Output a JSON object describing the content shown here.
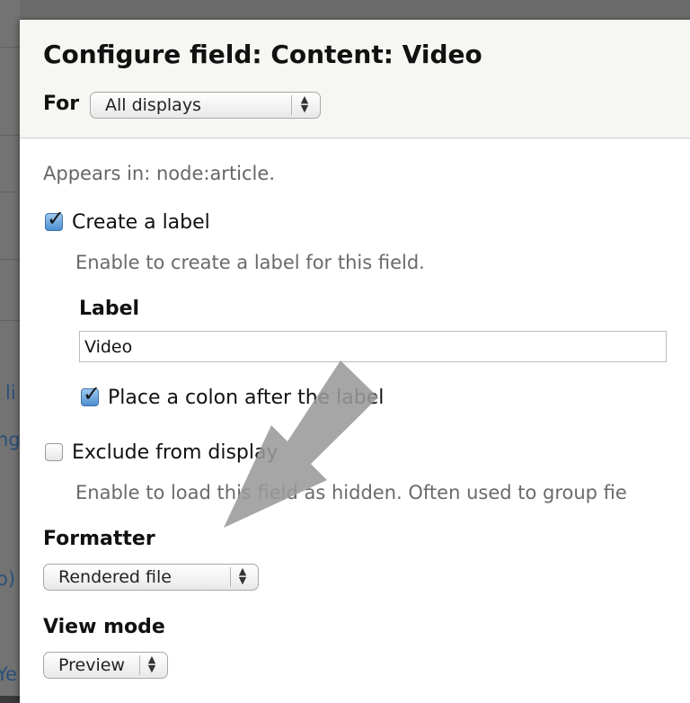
{
  "dialog": {
    "title": "Configure field: Content: Video",
    "for_label": "For",
    "display_select": {
      "value": "All displays",
      "arrow_icon": "updown-arrows-icon"
    }
  },
  "appears_in": "Appears in: node:article.",
  "create_label": {
    "label": "Create a label",
    "checked": true,
    "description": "Enable to create a label for this field."
  },
  "label_field": {
    "title": "Label",
    "value": "Video"
  },
  "colon": {
    "label": "Place a colon after the label",
    "checked": true
  },
  "exclude": {
    "label": "Exclude from display",
    "checked": false,
    "description": "Enable to load this field as hidden. Often used to group fie"
  },
  "formatter": {
    "title": "Formatter",
    "value": "Rendered file"
  },
  "view_mode": {
    "title": "View mode",
    "value": "Preview"
  },
  "background_fragments": [
    "li",
    "ng",
    "o)",
    "Ye"
  ],
  "colors": {
    "checkbox_checked": "#4d8ed0",
    "arrow_overlay": "#9a9a9a",
    "header_bg": "#f6f6f2"
  },
  "icons": {
    "checkmark": "checkmark-icon",
    "select_arrows": "updown-arrows-icon",
    "annotation_arrow": "annotation-arrow-icon"
  }
}
